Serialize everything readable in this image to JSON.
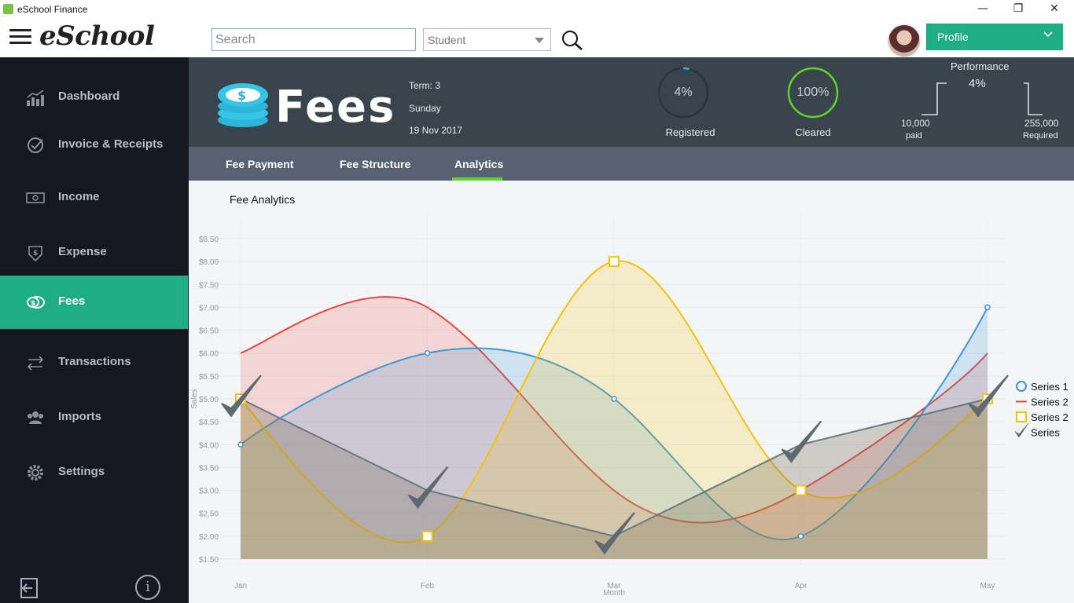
{
  "window": {
    "title": "eSchool Finance",
    "minimize": "—",
    "maximize": "❐",
    "close": "✕"
  },
  "topbar": {
    "logo": "eSchool",
    "search_placeholder": "Search",
    "filter_value": "Student",
    "profile_label": "Profile"
  },
  "sidebar": {
    "items": [
      {
        "label": "Dashboard",
        "icon": "dashboard-icon"
      },
      {
        "label": "Invoice & Receipts",
        "icon": "check-circle-icon"
      },
      {
        "label": "Income",
        "icon": "money-icon"
      },
      {
        "label": "Expense",
        "icon": "expense-icon"
      },
      {
        "label": "Fees",
        "icon": "coins-icon"
      },
      {
        "label": "Transactions",
        "icon": "transfer-icon"
      },
      {
        "label": "Imports",
        "icon": "users-icon"
      },
      {
        "label": "Settings",
        "icon": "gear-icon"
      }
    ],
    "active": "Fees",
    "info_label": "i"
  },
  "header": {
    "title": "Fees",
    "term": "Term: 3",
    "day": "Sunday",
    "date": "19 Nov 2017",
    "registered": {
      "value": "4%",
      "label": "Registered",
      "fraction": 0.04
    },
    "cleared": {
      "value": "100%",
      "label": "Cleared",
      "fraction": 1.0
    },
    "performance": {
      "title": "Performance",
      "value": "4%",
      "paid_amount": "10,000",
      "paid_label": "paid",
      "required_amount": "255,000",
      "required_label": "Required"
    }
  },
  "tabs": [
    {
      "label": "Fee Payment"
    },
    {
      "label": "Fee Structure"
    },
    {
      "label": "Analytics"
    }
  ],
  "active_tab": "Analytics",
  "content": {
    "title": "Fee Analytics"
  },
  "colors": {
    "accent": "#1fad86",
    "tab_indicator": "#63d42b",
    "sidebar_bg": "#151820",
    "header_bg": "#3a444d"
  },
  "chart_data": {
    "type": "area",
    "categories": [
      "Jan",
      "Feb",
      "Mar",
      "Apr",
      "May"
    ],
    "xlabel": "Month",
    "ylabel": "Sales",
    "ylim": [
      1.5,
      8.5
    ],
    "yticks": [
      "$1.50",
      "$2.00",
      "$2.50",
      "$3.00",
      "$3.50",
      "$4.00",
      "$4.50",
      "$5.00",
      "$5.50",
      "$6.00",
      "$6.50",
      "$7.00",
      "$7.50",
      "$8.00",
      "$8.50"
    ],
    "series": [
      {
        "name": "Series 1",
        "color": "#3d97d3",
        "marker": "circle",
        "values": [
          4,
          6,
          5,
          2,
          7
        ]
      },
      {
        "name": "Series 2",
        "color": "#e8463a",
        "marker": "line",
        "values": [
          6,
          7,
          3,
          3,
          6
        ]
      },
      {
        "name": "Series 2",
        "color": "#f4c10e",
        "marker": "square",
        "values": [
          5,
          2,
          8,
          3,
          5
        ]
      },
      {
        "name": "Series",
        "color": "#687880",
        "marker": "check",
        "values": [
          5,
          3,
          2,
          4,
          5
        ]
      }
    ],
    "legend": "right"
  }
}
